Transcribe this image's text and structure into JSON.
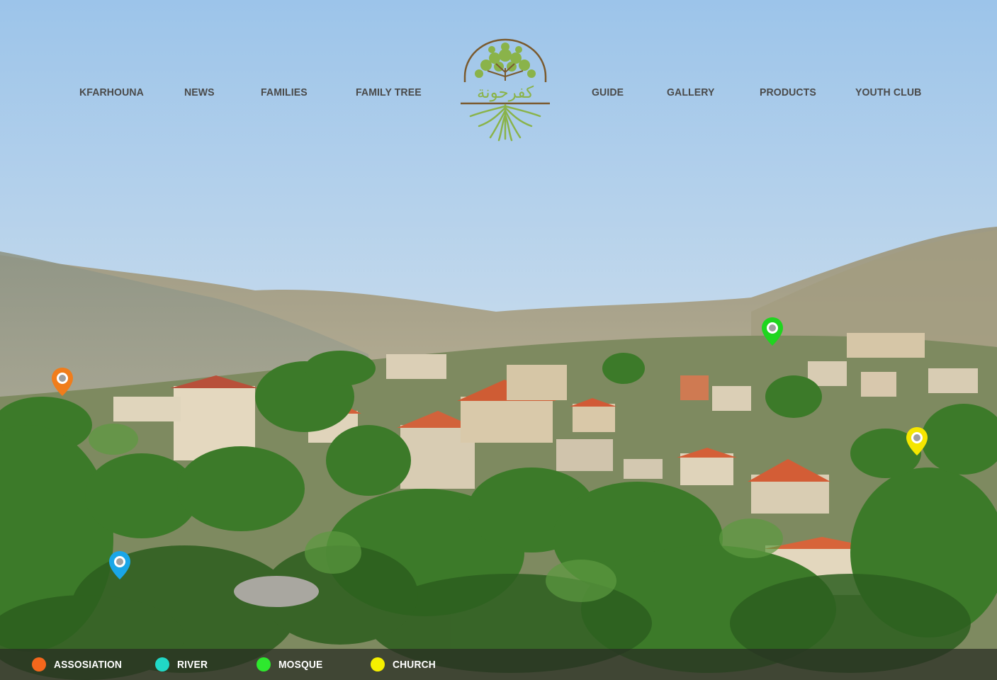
{
  "nav": {
    "left": [
      "KFARHOUNA",
      "NEWS",
      "FAMILIES",
      "FAMILY TREE"
    ],
    "right": [
      "GUIDE",
      "GALLERY",
      "PRODUCTS",
      "YOUTH CLUB"
    ]
  },
  "logo": {
    "text": "كفرحونة",
    "icon": "tree-roots-icon"
  },
  "markers": [
    {
      "type": "assosiation",
      "color": "#f07d1c"
    },
    {
      "type": "river",
      "color": "#1aa6e8"
    },
    {
      "type": "mosque",
      "color": "#1fd51f"
    },
    {
      "type": "church",
      "color": "#f5e600"
    }
  ],
  "legend": [
    {
      "label": "ASSOSIATION",
      "color": "#f4671c"
    },
    {
      "label": "RIVER",
      "color": "#21d8c6"
    },
    {
      "label": "MOSQUE",
      "color": "#2ee82e"
    },
    {
      "label": "CHURCH",
      "color": "#f5f000"
    }
  ],
  "colors": {
    "sky_top": "#9cc4ea",
    "sky_bottom": "#dce7ee",
    "foliage": "#3d7a2a",
    "roof": "#d45a33"
  }
}
